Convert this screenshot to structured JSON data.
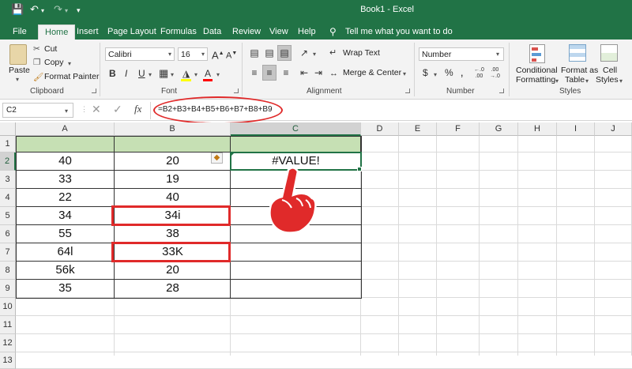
{
  "app": {
    "title": "Book1  -  Excel",
    "accent": "#217346"
  },
  "tabs": [
    "File",
    "Home",
    "Insert",
    "Page Layout",
    "Formulas",
    "Data",
    "Review",
    "View",
    "Help"
  ],
  "tell_me": "Tell me what you want to do",
  "ribbon": {
    "paste": "Paste",
    "cut": "Cut",
    "copy": "Copy",
    "format_painter": "Format Painter",
    "clipboard": "Clipboard",
    "font_name": "Calibri",
    "font_size": "16",
    "font_group": "Font",
    "wrap_text": "Wrap Text",
    "merge_center": "Merge & Center",
    "alignment": "Alignment",
    "number_format": "Number",
    "number_group": "Number",
    "conditional_1": "Conditional",
    "conditional_2": "Formatting",
    "format_table_1": "Format as",
    "format_table_2": "Table",
    "cell_styles_1": "Cell",
    "cell_styles_2": "Styles",
    "styles_group": "Styles"
  },
  "formula_bar": {
    "name_box": "C2",
    "formula": "=B2+B3+B4+B5+B6+B7+B8+B9"
  },
  "columns": [
    "A",
    "B",
    "C",
    "D",
    "E",
    "F",
    "G",
    "H",
    "I",
    "J"
  ],
  "rows": [
    "1",
    "2",
    "3",
    "4",
    "5",
    "6",
    "7",
    "8",
    "9",
    "10",
    "11",
    "12",
    "13"
  ],
  "cells": {
    "A": [
      "",
      "40",
      "33",
      "22",
      "34",
      "55",
      "64l",
      "56k",
      "35"
    ],
    "B": [
      "",
      "20",
      "19",
      "40",
      "34i",
      "38",
      "33K",
      "20",
      "28"
    ],
    "C2": "#VALUE!"
  },
  "colors": {
    "highlight": "#e02a2a",
    "header_fill": "#c6e0b4"
  }
}
